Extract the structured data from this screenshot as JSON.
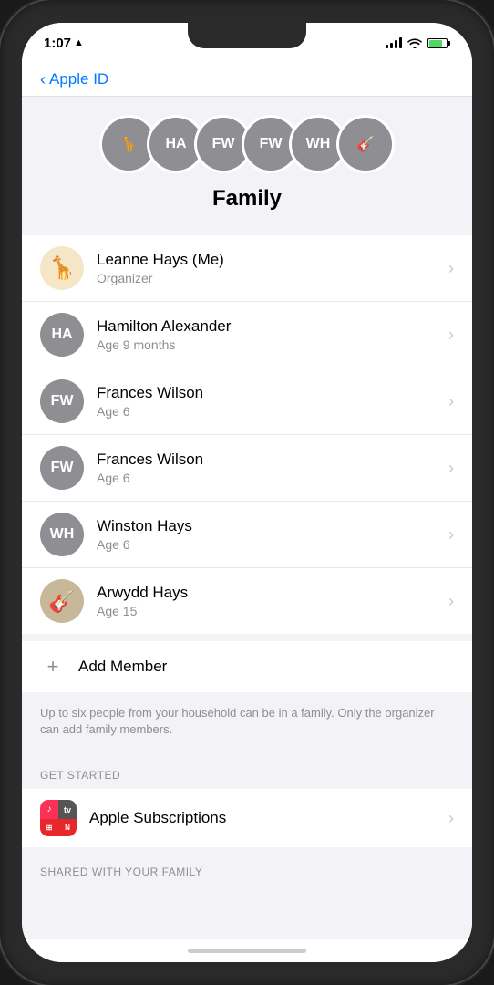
{
  "status": {
    "time": "1:07",
    "location_icon": "▲"
  },
  "nav": {
    "back_label": "Apple ID",
    "back_arrow": "‹"
  },
  "family": {
    "title": "Family",
    "avatars": [
      {
        "id": "leanne",
        "type": "giraffe",
        "emoji": "🦒"
      },
      {
        "id": "hamilton",
        "type": "initials",
        "initials": "HA"
      },
      {
        "id": "frances1",
        "type": "initials",
        "initials": "FW"
      },
      {
        "id": "frances2",
        "type": "initials",
        "initials": "FW"
      },
      {
        "id": "winston",
        "type": "initials",
        "initials": "WH"
      },
      {
        "id": "arwydd",
        "type": "photo",
        "emoji": "🎸"
      }
    ],
    "members": [
      {
        "id": "leanne",
        "type": "giraffe",
        "emoji": "🦒",
        "name": "Leanne Hays  (Me)",
        "sub": "Organizer"
      },
      {
        "id": "hamilton",
        "type": "initials",
        "initials": "HA",
        "name": "Hamilton Alexander",
        "sub": "Age 9 months"
      },
      {
        "id": "frances1",
        "type": "initials",
        "initials": "FW",
        "name": "Frances Wilson",
        "sub": "Age 6"
      },
      {
        "id": "frances2",
        "type": "initials",
        "initials": "FW",
        "name": "Frances Wilson",
        "sub": "Age 6"
      },
      {
        "id": "winston",
        "type": "initials",
        "initials": "WH",
        "name": "Winston Hays",
        "sub": "Age 6"
      },
      {
        "id": "arwydd",
        "type": "photo",
        "emoji": "🎸",
        "name": "Arwydd Hays",
        "sub": "Age 15"
      }
    ],
    "add_member_label": "Add Member",
    "info_text": "Up to six people from your household can be in a family. Only the organizer can add family members.",
    "get_started_label": "GET STARTED",
    "subscriptions_label": "Apple Subscriptions",
    "shared_label": "SHARED WITH YOUR FAMILY"
  }
}
